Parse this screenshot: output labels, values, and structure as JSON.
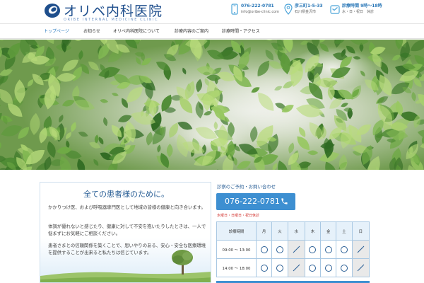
{
  "header": {
    "logo_text": "オリベ内科医院",
    "logo_sub": "ORIBE INTERNAL MEDICINE CLINIC",
    "phone": "076-222-0781",
    "email": "info@oribe-clinic.com",
    "address_main": "彦三町1-5-33",
    "address_sub": "石川県金沢市",
    "closed_main": "診療時間 9時～18時",
    "closed_sub": "水・日・祝日　休診"
  },
  "nav": {
    "items": [
      {
        "label": "トップページ"
      },
      {
        "label": "お知らせ"
      },
      {
        "label": "オリベ内科医院について"
      },
      {
        "label": "診療内容のご案内"
      },
      {
        "label": "診療時間・アクセス"
      }
    ]
  },
  "greeting": {
    "title": "全ての患者様のために。",
    "paragraphs": [
      "かかりつけ医、および呼吸器専門医として地域の皆様の健康と向き合います。",
      "体調が優れないと感じたり、健康に対して不安を抱いたりしたときは、一人で悩まずにお気軽にご相談ください。",
      "患者さまとの信頼関係を築くことで、思いやりのある、安心・安全な医療環境を提供することが出来ると私たちは信じています。"
    ]
  },
  "contact": {
    "label": "診察のご予約・お問い合わせ",
    "phone": "076-222-0781",
    "closed_note": "水曜日・日曜日・祝日休診"
  },
  "hours": {
    "header_label": "診療時間",
    "days": [
      "月",
      "火",
      "水",
      "木",
      "金",
      "土",
      "日"
    ],
    "rows": [
      {
        "time": "09:00 ～ 13:00",
        "marks": [
          "open",
          "open",
          "closed",
          "open",
          "open",
          "open",
          "closed"
        ]
      },
      {
        "time": "14:00 ～ 18:00",
        "marks": [
          "open",
          "open",
          "closed",
          "open",
          "open",
          "open",
          "closed"
        ]
      }
    ]
  },
  "colors": {
    "brand": "#1e4e8c",
    "accent": "#3d8fd1",
    "alert": "#d2342f",
    "table_border": "#a9c8e3"
  },
  "icons": {
    "phone": "phone-icon",
    "location": "map-pin-icon",
    "calendar": "calendar-icon"
  }
}
